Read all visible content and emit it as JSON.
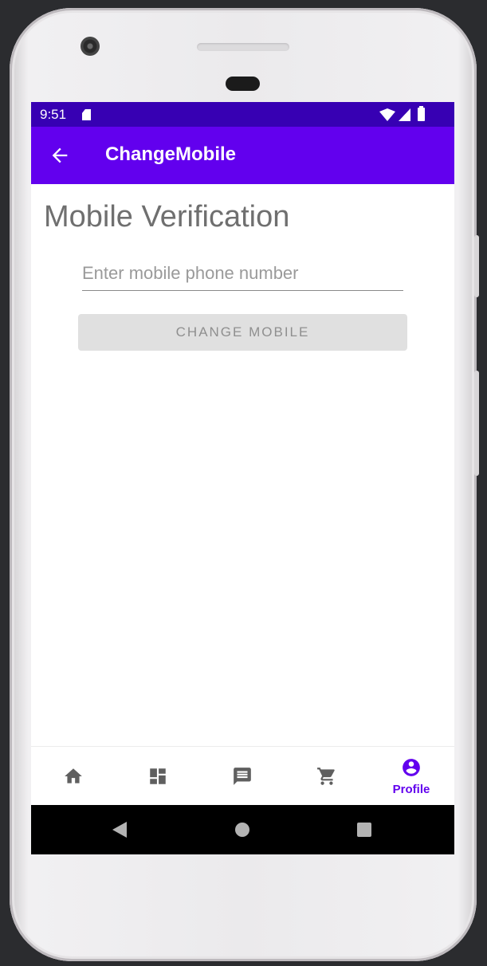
{
  "status_bar": {
    "time": "9:51",
    "icons": [
      "sd-card-icon",
      "wifi-icon",
      "cell-signal-icon",
      "battery-icon"
    ]
  },
  "app_bar": {
    "back_icon": "arrow-back-icon",
    "title": "ChangeMobile"
  },
  "main": {
    "heading": "Mobile Verification",
    "phone_input": {
      "value": "",
      "placeholder": "Enter mobile phone number"
    },
    "change_button": {
      "label": "CHANGE MOBILE",
      "enabled": false
    }
  },
  "bottom_nav": {
    "items": [
      {
        "icon": "home-icon",
        "label": "",
        "active": false
      },
      {
        "icon": "dashboard-icon",
        "label": "",
        "active": false
      },
      {
        "icon": "message-icon",
        "label": "",
        "active": false
      },
      {
        "icon": "cart-icon",
        "label": "",
        "active": false
      },
      {
        "icon": "profile-icon",
        "label": "Profile",
        "active": true
      }
    ]
  },
  "system_nav": {
    "buttons": [
      "back",
      "home",
      "recents"
    ]
  },
  "colors": {
    "status_bar": "#3700b3",
    "primary": "#6200ee",
    "heading_text": "#6f6f6f",
    "button_disabled_bg": "#e0e0e0",
    "nav_inactive": "#5f5f5f"
  }
}
